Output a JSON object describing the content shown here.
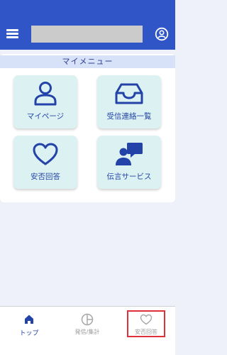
{
  "header": {
    "menu_icon": "hamburger-icon",
    "account_icon": "account-circle-icon",
    "background_color": "#2f55c7"
  },
  "menu": {
    "title": "マイメニュー",
    "tiles": [
      {
        "label": "マイページ",
        "icon": "person-icon"
      },
      {
        "label": "受信連絡一覧",
        "icon": "inbox-tray-icon"
      },
      {
        "label": "安否回答",
        "icon": "heart-icon"
      },
      {
        "label": "伝言サービス",
        "icon": "person-message-icon"
      }
    ]
  },
  "bottom_nav": {
    "items": [
      {
        "label": "トップ",
        "icon": "home-icon",
        "active": true
      },
      {
        "label": "発信/集計",
        "icon": "pie-chart-icon",
        "active": false
      },
      {
        "label": "安否回答",
        "icon": "heart-icon",
        "active": false,
        "highlighted": true
      }
    ]
  },
  "colors": {
    "primary": "#2f55c7",
    "tile_background": "#dcf2f2",
    "highlight": "#e0303a"
  }
}
